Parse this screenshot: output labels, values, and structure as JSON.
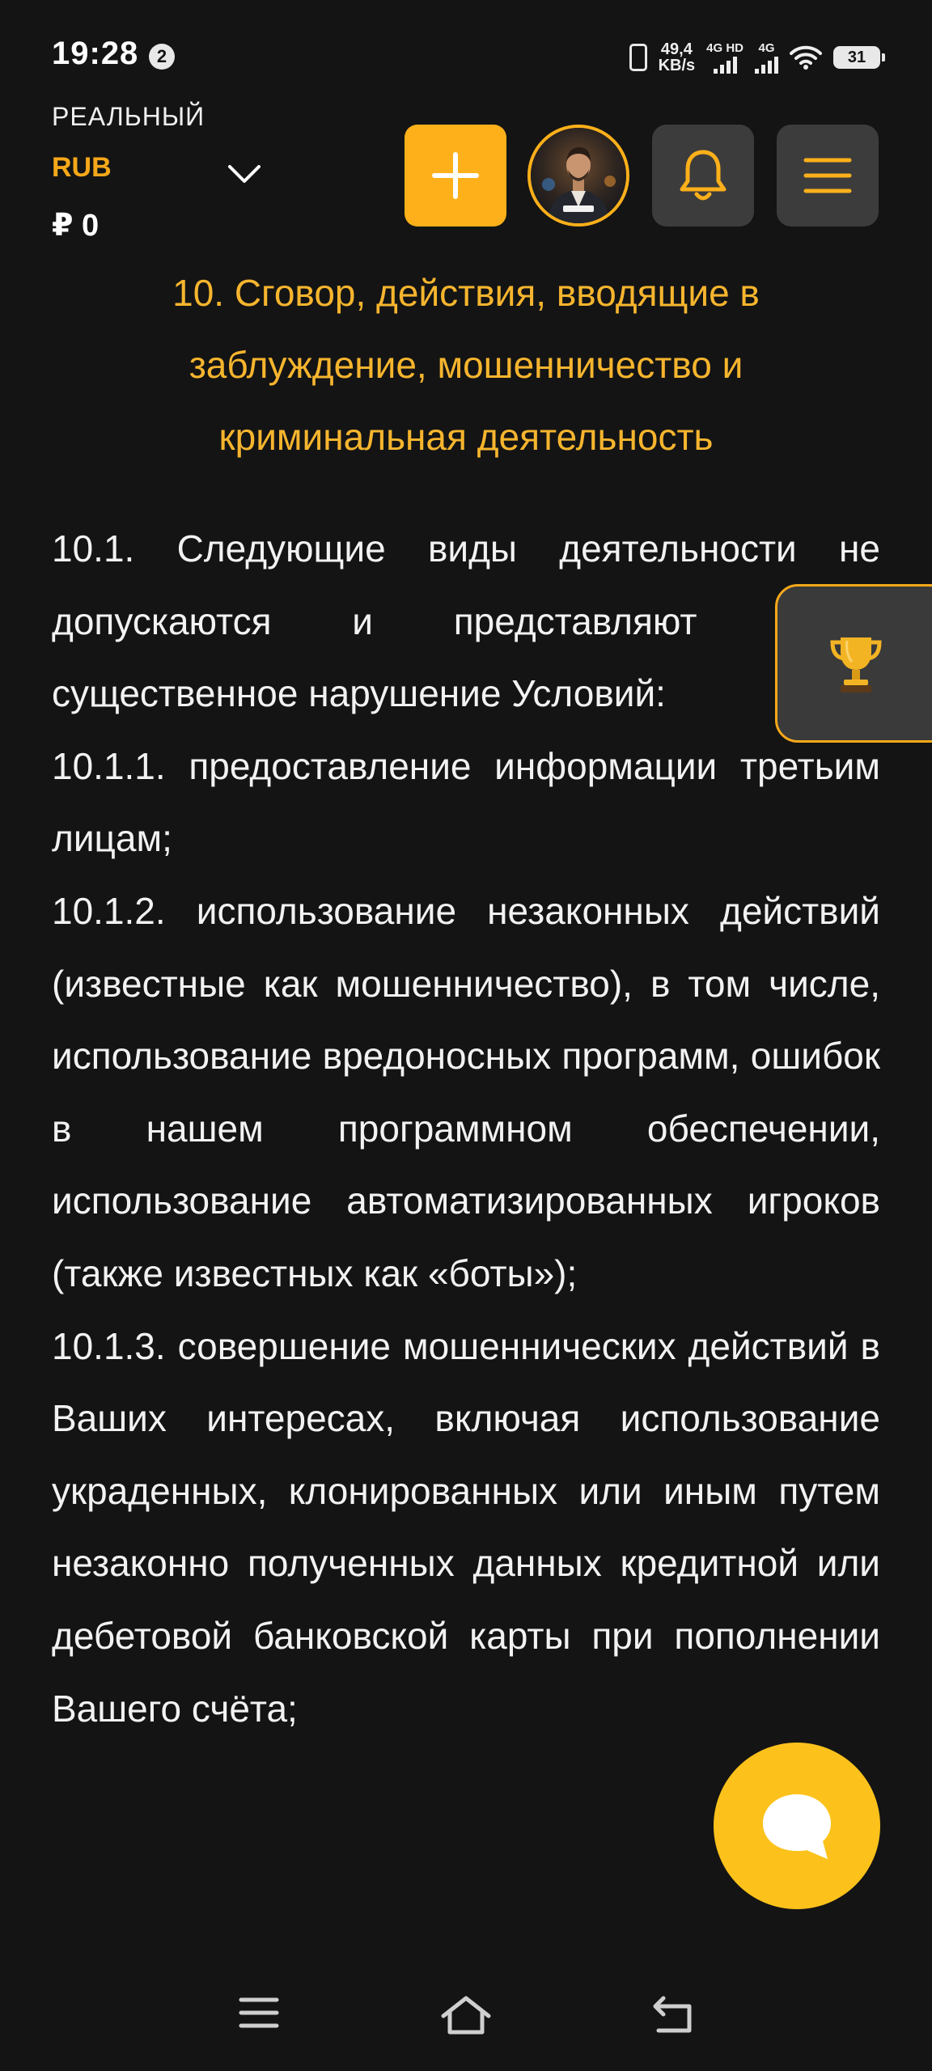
{
  "status_bar": {
    "time": "19:28",
    "notification_count": "2",
    "speed_value": "49,4",
    "speed_unit": "KB/s",
    "network_1": "4G HD",
    "network_2": "4G",
    "battery": "31"
  },
  "header": {
    "account_type": "РЕАЛЬНЫЙ",
    "currency": "RUB",
    "balance": "₽ 0",
    "accent_color": "#fdb01a"
  },
  "section": {
    "title": "10. Сговор, действия, вводящие в заблуждение, мошенничество и криминальная деятельность",
    "paragraphs": [
      "10.1. Следующие виды деятельности не допускаются и представляют собой существенное нарушение Условий:",
      "10.1.1. предоставление информации третьим лицам;",
      "10.1.2. использование незаконных действий (известные как мошенничество), в том числе, использование вредоносных программ, ошибок в нашем программном обеспечении, использование автоматизированных игроков (также известных как «боты»);",
      "10.1.3. совершение мошеннических действий в Ваших интересах, включая использование украденных, клонированных или иным путем незаконно полученных данных кредитной или дебетовой банковской карты при пополнении Вашего счёта;"
    ]
  },
  "icons": {
    "add": "plus-icon",
    "bell": "bell-icon",
    "menu": "hamburger-icon",
    "trophy": "trophy-icon",
    "chat": "chat-icon"
  }
}
